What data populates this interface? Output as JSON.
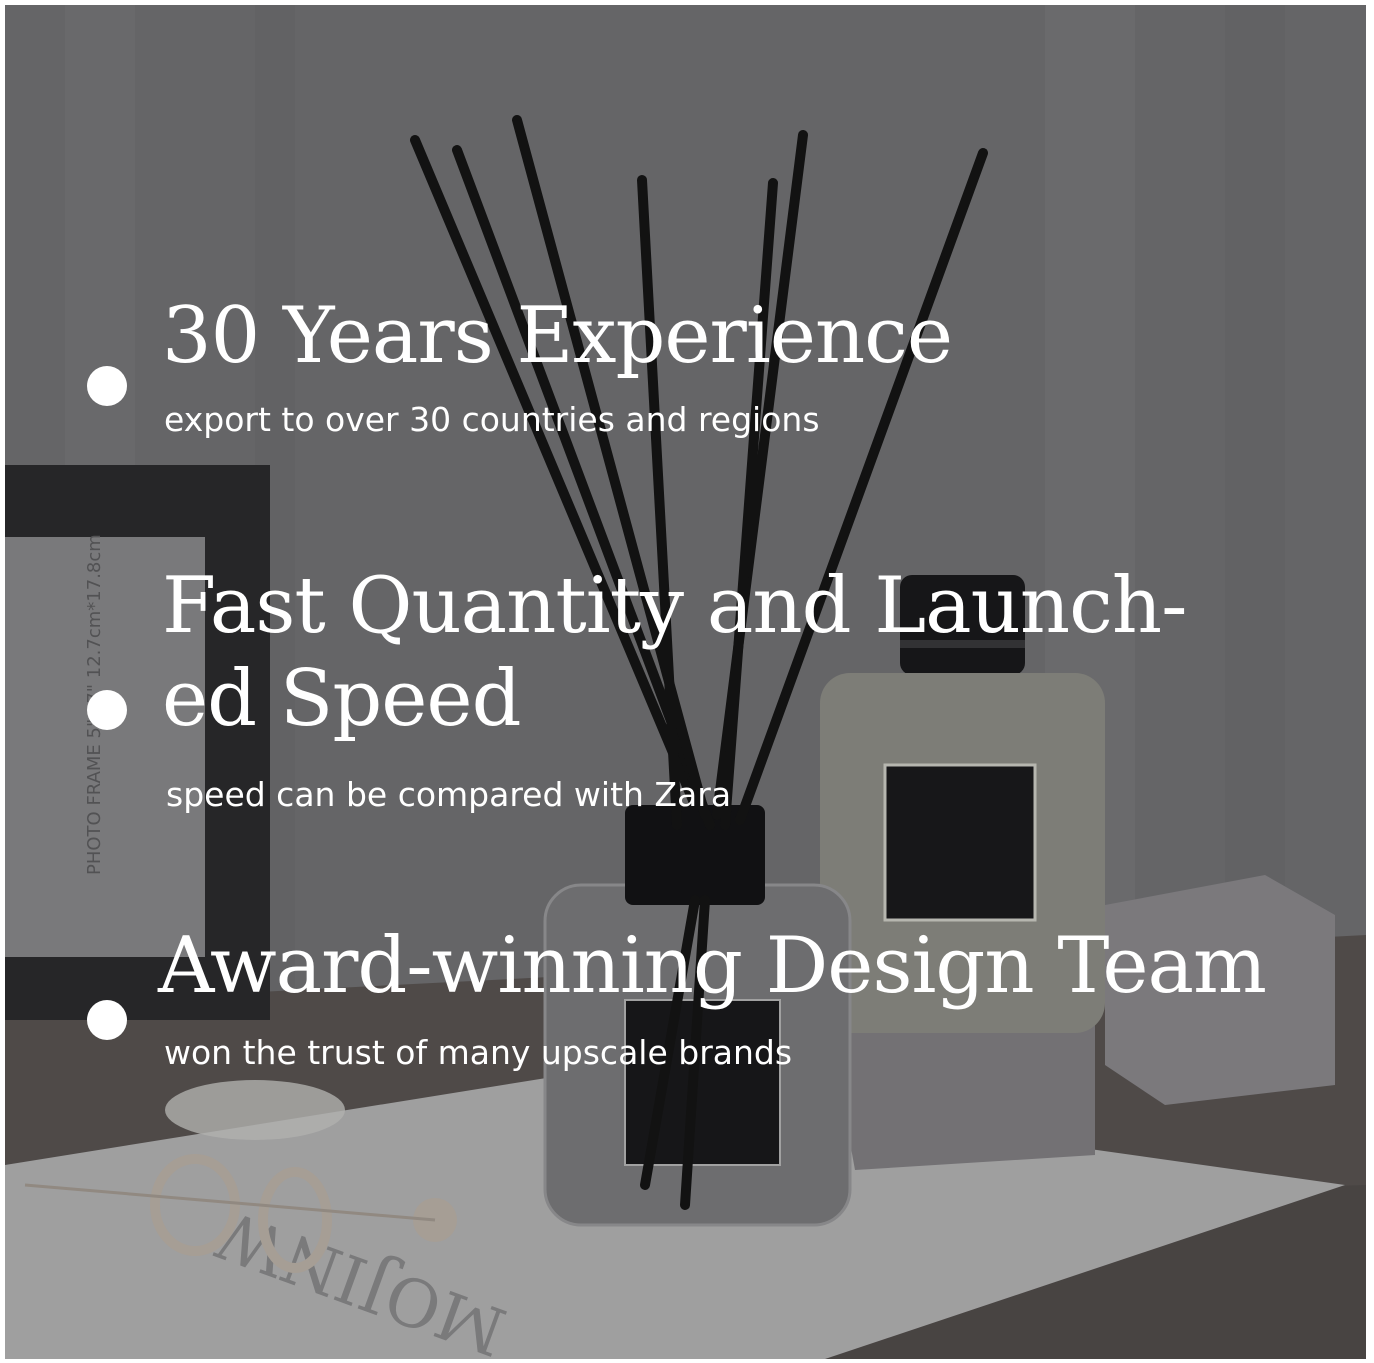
{
  "features": [
    {
      "title": "30 Years Experience",
      "subtitle": "export to over 30 countries and regions"
    },
    {
      "title_line1": "Fast Quantity and Launch-",
      "title_line2": "ed Speed",
      "subtitle": "speed can be compared with Zara"
    },
    {
      "title": "Award-winning Design Team",
      "subtitle": "won the trust of many upscale brands"
    }
  ],
  "background_photo": {
    "frame_text": "PHOTO FRAME 5\"×7\" 12.7cm*17.8cm",
    "card_text": "MOJINW"
  },
  "colors": {
    "overlay": "#6f6f71",
    "text": "#ffffff",
    "reeds": "#151515"
  }
}
